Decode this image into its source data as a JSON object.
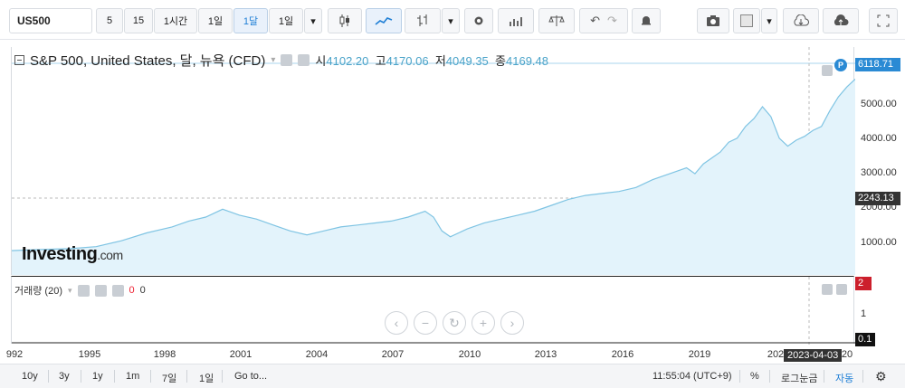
{
  "toolbar": {
    "symbol": "US500",
    "intervals": [
      "5",
      "15",
      "1시간",
      "1일",
      "1달",
      "1일"
    ],
    "active_interval_index": 4
  },
  "legend": {
    "title": "S&P 500, United States, 달, 뉴욕 (CFD)",
    "open_label": "시",
    "open_value": "4102.20",
    "high_label": "고",
    "high_value": "4170.06",
    "low_label": "저",
    "low_value": "4049.35",
    "close_label": "종",
    "close_value": "4169.48"
  },
  "logo": {
    "main": "Investing",
    "suffix": ".com"
  },
  "y_axis": {
    "labels": [
      "5000.00",
      "4000.00",
      "3000.00",
      "2000.00",
      "1000.00"
    ],
    "current_price": "6118.71",
    "crosshair_price": "2243.13"
  },
  "volume": {
    "label": "거래량 (20)",
    "val1": "0",
    "val2": "0",
    "axis_top": "2",
    "axis_mid": "1",
    "axis_bottom": "0.1"
  },
  "x_axis": {
    "labels": [
      "992",
      "1995",
      "1998",
      "2001",
      "2004",
      "2007",
      "2010",
      "2013",
      "2016",
      "2019",
      "202",
      "20"
    ],
    "crosshair_date": "2023-04-03"
  },
  "bottombar": {
    "ranges": [
      "10y",
      "3y",
      "1y",
      "1m",
      "7일",
      "1일"
    ],
    "goto": "Go to...",
    "time": "11:55:04 (UTC+9)",
    "percent": "%",
    "log": "로그눈금",
    "auto": "자동"
  },
  "colors": {
    "line": "#7fc4e3",
    "fill": "#e3f3fb",
    "accent": "#1f7fd6",
    "price_tag": "#2a8ad4",
    "crosshair_tag": "#333333",
    "vol_red": "#cc1f2c"
  }
}
